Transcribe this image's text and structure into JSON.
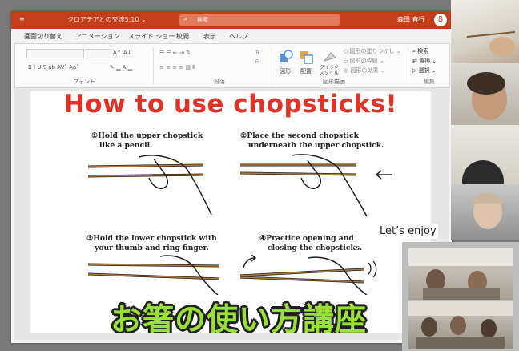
{
  "app": {
    "title_doc": "クロアチアとの交流5.10 ⌄",
    "search_placeholder": "検索",
    "user_name": "森田 春行",
    "avatar_letter": "8",
    "accent": "#c43e1c"
  },
  "menu": [
    "画面切り替え",
    "アニメーション",
    "スライド ショー",
    "校閲",
    "表示",
    "ヘルプ"
  ],
  "ribbon": {
    "groups": [
      "フォント",
      "段落",
      "図形描画",
      "編集"
    ],
    "font_size_label": "A↑ A↓",
    "format_row": "B  I  U  S  ab  AV˅  Aa˅",
    "shape_label": "図形",
    "arrange_label": "配置",
    "quick_style_label": "クイック\nスタイル",
    "fill_label": "図形の塗りつぶし",
    "outline_label": "図形の枠線",
    "effect_label": "図形の効果",
    "edit_find": "検索",
    "edit_replace": "置換",
    "edit_select": "選択"
  },
  "slide": {
    "title": "How to use chopsticks!",
    "steps": [
      {
        "text_l1": "①Hold the upper chopstick",
        "text_l2": "like a pencil."
      },
      {
        "text_l1": "②Place the second chopstick",
        "text_l2": "underneath the upper chopstick."
      },
      {
        "text_l1": "③Hold the lower chopstick with",
        "text_l2": "your thumb and ring finger."
      },
      {
        "text_l1": "④Practice opening and",
        "text_l2": "closing the chopsticks."
      }
    ],
    "banner": "お箸の使い方講座"
  },
  "overlay": {
    "caption": "Let’s enjoy"
  }
}
